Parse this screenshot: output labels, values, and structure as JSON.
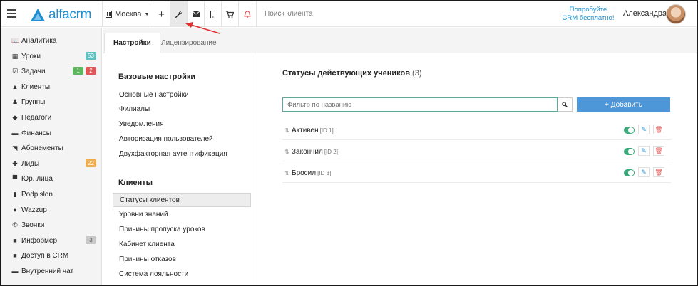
{
  "header": {
    "logo_text": "alfacrm",
    "branch": "Москва",
    "search_placeholder": "Поиск клиента",
    "promo_line1": "Попробуйте",
    "promo_line2": "CRM бесплатно!",
    "user_name": "Александра"
  },
  "colors": {
    "accent": "#1f8fd0",
    "primary_button": "#4d97d8",
    "toggle_on": "#3aaa7a",
    "badge_teal": "#5bc0c0",
    "badge_green": "#5cb85c",
    "badge_red": "#e05555",
    "badge_orange": "#f0ad4e",
    "badge_grey": "#c8c8c8",
    "annotation_arrow": "#e0302e"
  },
  "sidebar": {
    "items": [
      {
        "label": "Аналитика",
        "icon": "book-icon"
      },
      {
        "label": "Уроки",
        "icon": "calendar-icon",
        "badges": [
          "53"
        ]
      },
      {
        "label": "Задачи",
        "icon": "tasks-icon",
        "badges": [
          "1",
          "2"
        ]
      },
      {
        "label": "Клиенты",
        "icon": "user-icon"
      },
      {
        "label": "Группы",
        "icon": "users-icon"
      },
      {
        "label": "Педагоги",
        "icon": "graduation-cap-icon"
      },
      {
        "label": "Финансы",
        "icon": "money-icon"
      },
      {
        "label": "Абонементы",
        "icon": "tag-icon"
      },
      {
        "label": "Лиды",
        "icon": "user-plus-icon",
        "badges": [
          "22"
        ]
      },
      {
        "label": "Юр. лица",
        "icon": "briefcase-icon"
      },
      {
        "label": "Podpislon",
        "icon": "file-icon"
      },
      {
        "label": "Wazzup",
        "icon": "whatsapp-icon"
      },
      {
        "label": "Звонки",
        "icon": "phone-icon"
      },
      {
        "label": "Информер",
        "icon": "informer-icon",
        "badges": [
          "3"
        ]
      },
      {
        "label": "Доступ в CRM",
        "icon": "lock-icon"
      },
      {
        "label": "Внутренний чат",
        "icon": "chat-icon"
      }
    ]
  },
  "tabs": [
    {
      "label": "Настройки",
      "active": true
    },
    {
      "label": "Лицензирование",
      "active": false
    }
  ],
  "settings_menu": {
    "basic_heading": "Базовые настройки",
    "basic_items": [
      "Основные настройки",
      "Филиалы",
      "Уведомления",
      "Авторизация пользователей",
      "Двухфакторная аутентификация"
    ],
    "clients_heading": "Клиенты",
    "clients_items": [
      "Статусы клиентов",
      "Уровни знаний",
      "Причины пропуска уроков",
      "Кабинет клиента",
      "Причины отказов",
      "Система лояльности"
    ],
    "active_item": "Статусы клиентов"
  },
  "main": {
    "title": "Статусы действующих учеников",
    "count": "(3)",
    "filter_placeholder": "Фильтр по названию",
    "add_button": "+ Добавить",
    "statuses": [
      {
        "name": "Активен",
        "id": "[ID 1]",
        "enabled": true
      },
      {
        "name": "Закончил",
        "id": "[ID 2]",
        "enabled": true
      },
      {
        "name": "Бросил",
        "id": "[ID 3]",
        "enabled": true
      }
    ]
  }
}
